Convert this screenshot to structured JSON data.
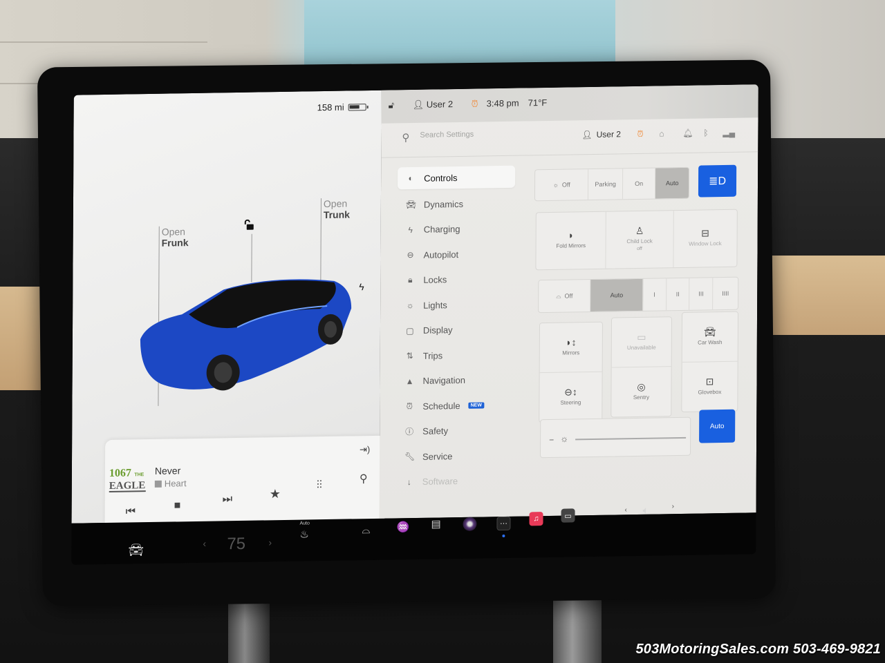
{
  "status_bar": {
    "range": "158 mi",
    "user": "User 2",
    "time": "3:48 pm",
    "temperature": "71°F"
  },
  "car_view": {
    "frunk": {
      "line1": "Open",
      "line2": "Frunk"
    },
    "trunk": {
      "line1": "Open",
      "line2": "Trunk"
    },
    "car_color": "#1c48c4"
  },
  "media": {
    "station_logo_top": "1067",
    "station_logo_tag": "THE",
    "station_logo_bottom": "EAGLE",
    "song": "Never",
    "artist": "Heart"
  },
  "settings": {
    "search_placeholder": "Search Settings",
    "header_user": "User 2",
    "nav": [
      {
        "label": "Controls",
        "icon": "toggle-icon",
        "active": true
      },
      {
        "label": "Dynamics",
        "icon": "car-icon"
      },
      {
        "label": "Charging",
        "icon": "bolt-icon"
      },
      {
        "label": "Autopilot",
        "icon": "steering-wheel-icon"
      },
      {
        "label": "Locks",
        "icon": "lock-icon"
      },
      {
        "label": "Lights",
        "icon": "sun-icon"
      },
      {
        "label": "Display",
        "icon": "display-icon"
      },
      {
        "label": "Trips",
        "icon": "trips-icon"
      },
      {
        "label": "Navigation",
        "icon": "navigation-arrow-icon"
      },
      {
        "label": "Schedule",
        "icon": "alarm-clock-icon",
        "badge": "NEW"
      },
      {
        "label": "Safety",
        "icon": "alert-circle-icon"
      },
      {
        "label": "Service",
        "icon": "wrench-icon"
      },
      {
        "label": "Software",
        "icon": "download-icon"
      }
    ],
    "headlights": {
      "options": [
        "Off",
        "Parking",
        "On",
        "Auto"
      ],
      "selected": "Auto"
    },
    "row_tiles": [
      {
        "label": "Fold Mirrors",
        "sub": ""
      },
      {
        "label": "Child Lock",
        "sub": "off"
      },
      {
        "label": "Window Lock",
        "sub": ""
      }
    ],
    "wipers": {
      "options": [
        "Off",
        "Auto",
        "I",
        "II",
        "III",
        "IIII"
      ],
      "selected": "Auto"
    },
    "grid_tiles": [
      {
        "label": "Mirrors"
      },
      {
        "label": "Steering"
      },
      {
        "label": "Unavailable"
      },
      {
        "label": "Sentry"
      },
      {
        "label": "Car Wash"
      },
      {
        "label": "Glovebox"
      }
    ],
    "brightness_auto": "Auto"
  },
  "bottom_bar": {
    "temperature": "75",
    "seat_heat_mode": "Auto"
  },
  "watermark": "503MotoringSales.com 503-469-9821",
  "colors": {
    "accent_blue": "#1960e0",
    "alarm_orange": "#f08a3a",
    "music_red": "#e83a58"
  }
}
